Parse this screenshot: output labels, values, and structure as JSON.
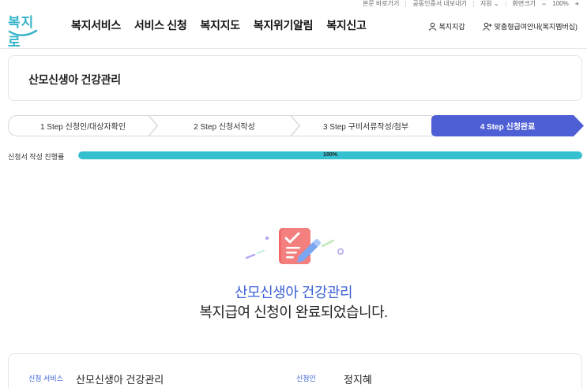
{
  "utility_bar": {
    "skip_link": "본문 바로가기",
    "cert_link": "공동인증서 내보내기",
    "support": "지원",
    "zoom_label": "화면크기",
    "zoom_minus": "−",
    "zoom_value": "100%",
    "zoom_plus": "+"
  },
  "logo": {
    "text": "복지로"
  },
  "nav": {
    "items": [
      {
        "label": "복지서비스"
      },
      {
        "label": "서비스 신청"
      },
      {
        "label": "복지지도"
      },
      {
        "label": "복지위기알림"
      },
      {
        "label": "복지신고"
      }
    ],
    "wallet": "복지지갑",
    "membership": "맞춤형급여안내(복지멤버십)"
  },
  "page_title": "산모신생아 건강관리",
  "steps": [
    {
      "label": "1 Step 신청인/대상자확인",
      "active": false
    },
    {
      "label": "2 Step 신청서작성",
      "active": false
    },
    {
      "label": "3 Step 구비서류작성/첨부",
      "active": false
    },
    {
      "label": "4 Step 신청완료",
      "active": true
    }
  ],
  "progress": {
    "label": "신청서 작성 진행률",
    "value": 100,
    "text": "100%"
  },
  "completion": {
    "service_name": "산모신생아 건강관리",
    "message": "복지급여 신청이 완료되었습니다."
  },
  "summary": {
    "service_key": "신청 서비스",
    "service_value": "산모신생아 건강관리",
    "applicant_key": "신청인",
    "applicant_value": "정지혜"
  },
  "colors": {
    "accent": "#3a5fd6",
    "step_active": "#4e5fd6",
    "progress": "#35c0cf",
    "logo": "#36b4c9"
  }
}
